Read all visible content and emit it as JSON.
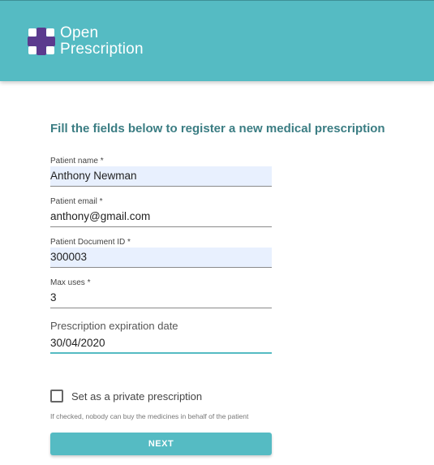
{
  "header": {
    "logo_line1": "Open",
    "logo_line2": "Prescription",
    "logo_icon": "medical-cross-icon"
  },
  "form": {
    "title": "Fill the fields below to register a new medical prescription",
    "fields": {
      "patient_name": {
        "label": "Patient name *",
        "value": "Anthony Newman"
      },
      "patient_email": {
        "label": "Patient email *",
        "value": "anthony@gmail.com"
      },
      "patient_document_id": {
        "label": "Patient Document ID *",
        "value": "300003"
      },
      "max_uses": {
        "label": "Max uses *",
        "value": "3"
      },
      "expiration_date": {
        "label": "Prescription expiration date",
        "value": "30/04/2020"
      }
    },
    "private_checkbox": {
      "label": "Set as a private prescription",
      "checked": false,
      "hint": "If checked, nobody can buy the medicines in behalf of the patient"
    },
    "next_label": "NEXT"
  },
  "colors": {
    "brand": "#55bbc3",
    "title": "#3b7d83",
    "autofill": "#e8f0fe",
    "logo_cross": "#5b3a8e"
  }
}
